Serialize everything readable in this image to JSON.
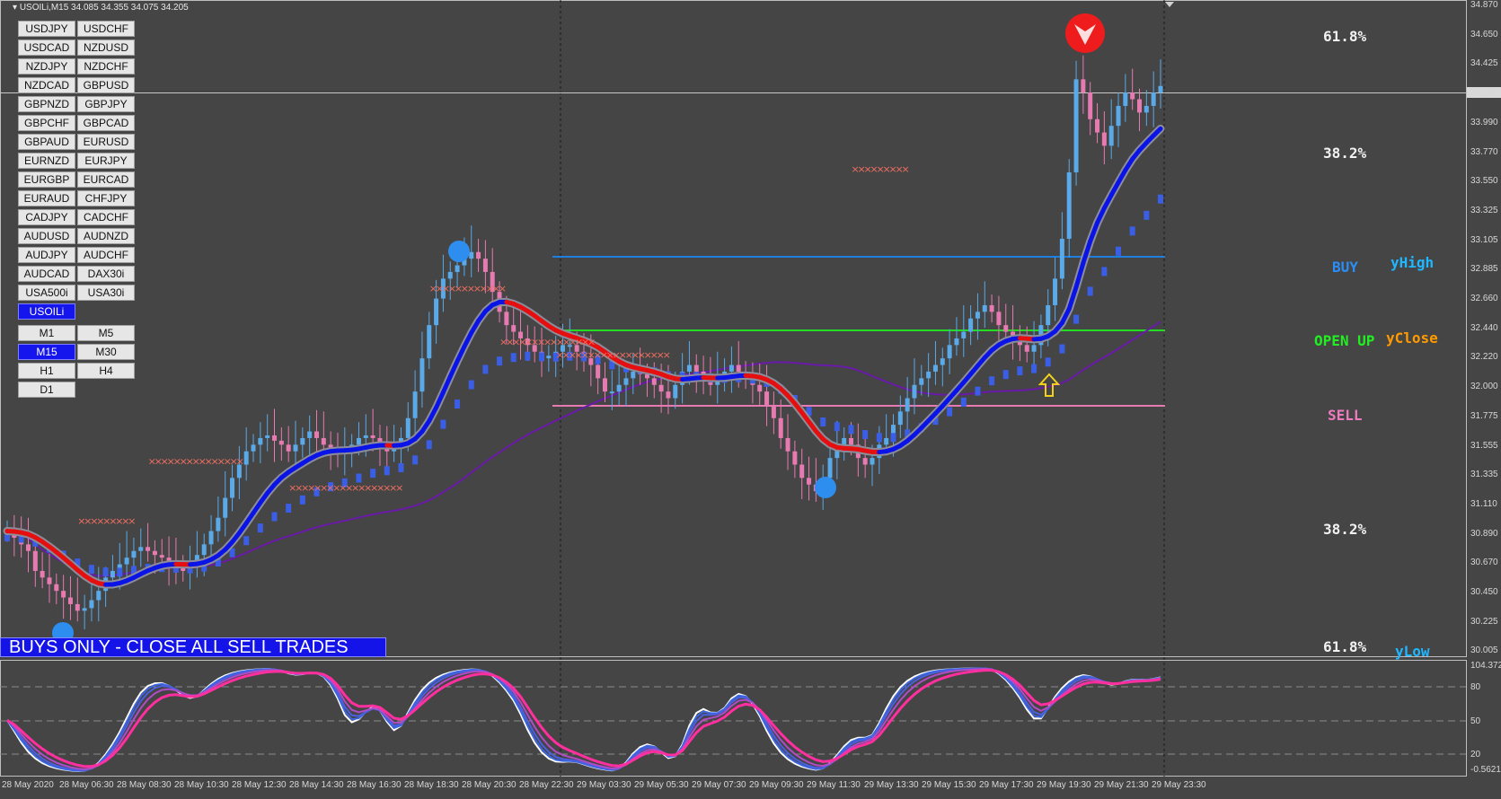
{
  "window": {
    "title": "USOILi,M15  34.085 34.355 34.075 34.205",
    "current_price": "34.205"
  },
  "symbol_buttons": [
    "USDJPY",
    "USDCHF",
    "USDCAD",
    "NZDUSD",
    "NZDJPY",
    "NZDCHF",
    "NZDCAD",
    "GBPUSD",
    "GBPNZD",
    "GBPJPY",
    "GBPCHF",
    "GBPCAD",
    "GBPAUD",
    "EURUSD",
    "EURNZD",
    "EURJPY",
    "EURGBP",
    "EURCAD",
    "EURAUD",
    "CHFJPY",
    "CADJPY",
    "CADCHF",
    "AUDUSD",
    "AUDNZD",
    "AUDJPY",
    "AUDCHF",
    "AUDCAD",
    "DAX30i",
    "USA500i",
    "USA30i",
    "USOILi"
  ],
  "active_symbol": "USOILi",
  "timeframe_buttons": [
    "M1",
    "M5",
    "M15",
    "M30",
    "H1",
    "H4",
    "D1"
  ],
  "active_timeframe": "M15",
  "banner": "BUYS ONLY - CLOSE ALL SELL TRADES",
  "levels": {
    "fib_top": "61.8%",
    "fib_upper": "38.2%",
    "buy": "BUY",
    "yhigh": "yHigh",
    "open_up": "OPEN UP",
    "yclose": "yClose",
    "sell": "SELL",
    "fib_lower": "38.2%",
    "fib_bottom": "61.8%",
    "ylow": "yLow"
  },
  "price_axis": [
    "34.870",
    "34.650",
    "34.425",
    "34.205",
    "33.990",
    "33.770",
    "33.550",
    "33.325",
    "33.105",
    "32.885",
    "32.660",
    "32.440",
    "32.220",
    "32.000",
    "31.775",
    "31.555",
    "31.335",
    "31.110",
    "30.890",
    "30.670",
    "30.450",
    "30.225",
    "30.005"
  ],
  "oscillator_axis": [
    "104.372",
    "80",
    "50",
    "20",
    "-0.5621"
  ],
  "time_axis": [
    "28 May 2020",
    "28 May 06:30",
    "28 May 08:30",
    "28 May 10:30",
    "28 May 12:30",
    "28 May 14:30",
    "28 May 16:30",
    "28 May 18:30",
    "28 May 20:30",
    "28 May 22:30",
    "29 May 03:30",
    "29 May 05:30",
    "29 May 07:30",
    "29 May 09:30",
    "29 May 11:30",
    "29 May 13:30",
    "29 May 15:30",
    "29 May 17:30",
    "29 May 19:30",
    "29 May 21:30",
    "29 May 23:30"
  ],
  "colors": {
    "background": "#454545",
    "bull_candle": "#5aa9e8",
    "bear_candle": "#e87ab2",
    "ma_blue": "#0a14e6",
    "ma_red": "#e60f0f",
    "buy_line": "#1e7fe0",
    "open_line": "#22dd22",
    "sell_line": "#e87ab2",
    "slow_ma": "#6a1aa8",
    "banner": "#1414e8"
  },
  "chart_data": {
    "type": "candlestick",
    "symbol": "USOILi",
    "timeframe": "M15",
    "close": [
      30.9,
      30.85,
      30.8,
      30.75,
      30.6,
      30.55,
      30.5,
      30.45,
      30.4,
      30.35,
      30.3,
      30.32,
      30.38,
      30.45,
      30.55,
      30.6,
      30.65,
      30.7,
      30.75,
      30.78,
      30.75,
      30.72,
      30.7,
      30.65,
      30.62,
      30.6,
      30.65,
      30.72,
      30.8,
      30.9,
      31.0,
      31.15,
      31.3,
      31.4,
      31.5,
      31.55,
      31.6,
      31.62,
      31.58,
      31.55,
      31.5,
      31.55,
      31.6,
      31.65,
      31.6,
      31.55,
      31.5,
      31.48,
      31.5,
      31.55,
      31.6,
      31.62,
      31.6,
      31.55,
      31.5,
      31.52,
      31.6,
      31.75,
      31.95,
      32.2,
      32.45,
      32.65,
      32.8,
      32.85,
      32.9,
      32.95,
      33.0,
      32.95,
      32.85,
      32.7,
      32.55,
      32.45,
      32.4,
      32.35,
      32.3,
      32.25,
      32.2,
      32.22,
      32.25,
      32.3,
      32.3,
      32.25,
      32.2,
      32.15,
      32.05,
      31.95,
      31.95,
      32.0,
      32.05,
      32.1,
      32.08,
      32.05,
      32.0,
      31.95,
      31.9,
      32.0,
      32.1,
      32.15,
      32.1,
      32.05,
      32.0,
      32.05,
      32.1,
      32.15,
      32.1,
      32.05,
      32.0,
      31.95,
      31.85,
      31.75,
      31.6,
      31.5,
      31.4,
      31.3,
      31.25,
      31.2,
      31.3,
      31.45,
      31.55,
      31.6,
      31.55,
      31.45,
      31.4,
      31.45,
      31.55,
      31.6,
      31.7,
      31.8,
      31.9,
      32.0,
      32.05,
      32.1,
      32.15,
      32.2,
      32.3,
      32.35,
      32.4,
      32.5,
      32.55,
      32.6,
      32.55,
      32.45,
      32.4,
      32.35,
      32.3,
      32.25,
      32.3,
      32.45,
      32.6,
      32.8,
      33.1,
      33.6,
      34.3,
      34.2,
      34.0,
      33.9,
      33.8,
      33.95,
      34.1,
      34.2,
      34.15,
      34.05,
      34.1,
      34.2,
      34.25
    ],
    "levels": {
      "BUY/yHigh": 32.93,
      "OPEN UP/yClose": 32.44,
      "SELL": 31.83
    },
    "oscillator_range": [
      -0.5621,
      104.372
    ],
    "oscillator_levels": [
      20,
      50,
      80
    ]
  }
}
